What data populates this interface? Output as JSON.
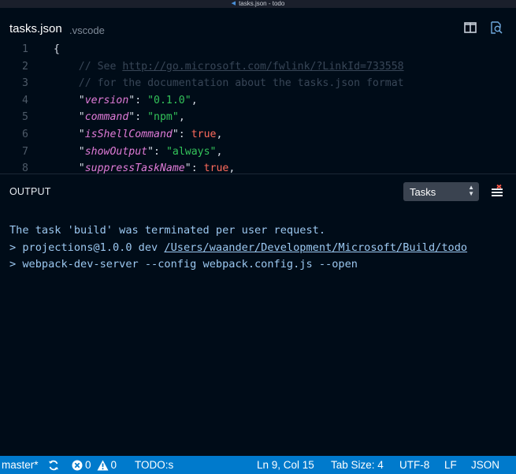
{
  "window": {
    "title": "tasks.json - todo"
  },
  "editor": {
    "filename": "tasks.json",
    "folder": ".vscode",
    "lines": [
      {
        "num": "1",
        "parts": [
          {
            "cls": "punc",
            "text": "{"
          }
        ]
      },
      {
        "num": "2",
        "parts": [
          {
            "cls": "comment",
            "text": "    // See "
          },
          {
            "cls": "link",
            "text": "http://go.microsoft.com/fwlink/?LinkId=733558"
          }
        ]
      },
      {
        "num": "3",
        "parts": [
          {
            "cls": "comment",
            "text": "    // for the documentation about the tasks.json format"
          }
        ]
      },
      {
        "num": "4",
        "parts": [
          {
            "cls": "punc",
            "text": "    \""
          },
          {
            "cls": "key",
            "text": "version"
          },
          {
            "cls": "punc",
            "text": "\": "
          },
          {
            "cls": "str",
            "text": "\"0.1.0\""
          },
          {
            "cls": "punc",
            "text": ","
          }
        ]
      },
      {
        "num": "5",
        "parts": [
          {
            "cls": "punc",
            "text": "    \""
          },
          {
            "cls": "key",
            "text": "command"
          },
          {
            "cls": "punc",
            "text": "\": "
          },
          {
            "cls": "str",
            "text": "\"npm\""
          },
          {
            "cls": "punc",
            "text": ","
          }
        ]
      },
      {
        "num": "6",
        "parts": [
          {
            "cls": "punc",
            "text": "    \""
          },
          {
            "cls": "key",
            "text": "isShellCommand"
          },
          {
            "cls": "punc",
            "text": "\": "
          },
          {
            "cls": "bool",
            "text": "true"
          },
          {
            "cls": "punc",
            "text": ","
          }
        ]
      },
      {
        "num": "7",
        "parts": [
          {
            "cls": "punc",
            "text": "    \""
          },
          {
            "cls": "key",
            "text": "showOutput"
          },
          {
            "cls": "punc",
            "text": "\": "
          },
          {
            "cls": "str",
            "text": "\"always\""
          },
          {
            "cls": "punc",
            "text": ","
          }
        ]
      },
      {
        "num": "8",
        "parts": [
          {
            "cls": "punc",
            "text": "    \""
          },
          {
            "cls": "key",
            "text": "suppressTaskName"
          },
          {
            "cls": "punc",
            "text": "\": "
          },
          {
            "cls": "bool",
            "text": "true"
          },
          {
            "cls": "punc",
            "text": ","
          }
        ]
      }
    ]
  },
  "panel": {
    "title": "OUTPUT",
    "task_select": "Tasks",
    "output": [
      {
        "text": "The task 'build' was terminated per user request."
      },
      {
        "text": "> projections@1.0.0 dev ",
        "link": "/Users/waander/Development/Microsoft/Build/todo"
      },
      {
        "text": "> webpack-dev-server --config webpack.config.js --open"
      }
    ]
  },
  "statusbar": {
    "branch": "master*",
    "errors": "0",
    "warnings": "0",
    "todo": "TODO:s",
    "position": "Ln 9, Col 15",
    "tab_size": "Tab Size: 4",
    "encoding": "UTF-8",
    "eol": "LF",
    "language": "JSON"
  },
  "colors": {
    "background": "#000c18",
    "statusbar": "#007acc",
    "key": "#e07bd8",
    "string": "#33c35a",
    "boolean": "#ff6b5c",
    "output_text": "#9cc8f0"
  }
}
